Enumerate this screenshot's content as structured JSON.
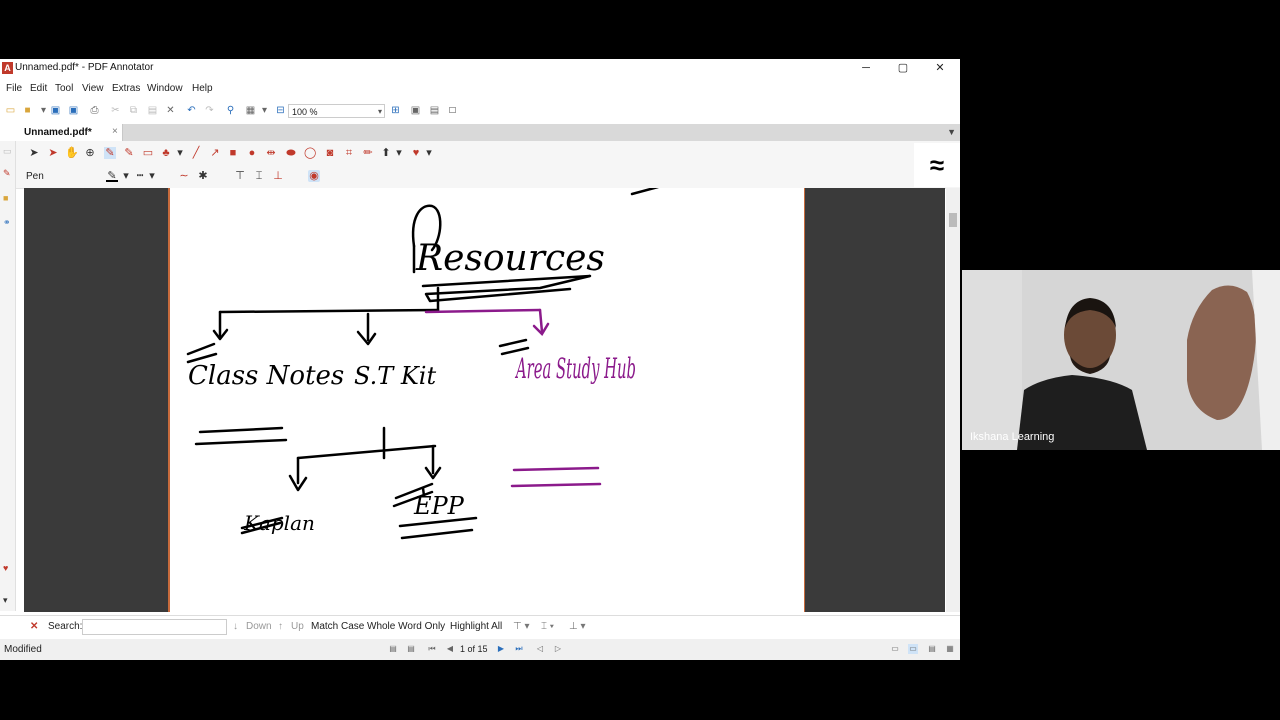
{
  "window": {
    "title": "Unnamed.pdf* - PDF Annotator",
    "minimize": "─",
    "maximize": "▢",
    "close": "✕"
  },
  "menu": [
    "File",
    "Edit",
    "Tool",
    "View",
    "Extras",
    "Window",
    "Help"
  ],
  "toolbar": {
    "zoom_value": "100 %"
  },
  "tab": {
    "label": "Unnamed.pdf*",
    "close": "×"
  },
  "tool_label": "Pen",
  "drawing": {
    "title": "Resources",
    "left": "Class Notes",
    "middle": "S.T Kit",
    "middle_left": "Kaplan",
    "middle_right": "EPP",
    "right": "Area Study Hub",
    "accent_color": "#8b1a8b"
  },
  "find": {
    "search_label": "Search:",
    "search_value": "",
    "down": "Down",
    "up": "Up",
    "match_case": "Match Case",
    "whole_word": "Whole Word Only",
    "highlight_all": "Highlight All"
  },
  "status": {
    "text": "Modified",
    "page_indicator": "1 of 15"
  },
  "video": {
    "participant_name": "Ikshana Learning"
  }
}
